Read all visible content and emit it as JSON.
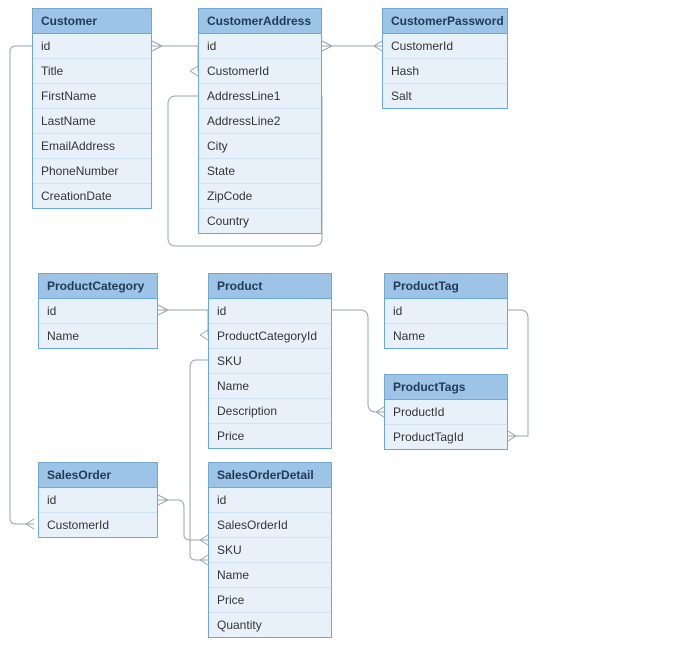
{
  "entities": {
    "customer": {
      "name": "Customer",
      "fields": [
        "id",
        "Title",
        "FirstName",
        "LastName",
        "EmailAddress",
        "PhoneNumber",
        "CreationDate"
      ]
    },
    "customerAddress": {
      "name": "CustomerAddress",
      "fields": [
        "id",
        "CustomerId",
        "AddressLine1",
        "AddressLine2",
        "City",
        "State",
        "ZipCode",
        "Country"
      ]
    },
    "customerPassword": {
      "name": "CustomerPassword",
      "fields": [
        "CustomerId",
        "Hash",
        "Salt"
      ]
    },
    "productCategory": {
      "name": "ProductCategory",
      "fields": [
        "id",
        "Name"
      ]
    },
    "product": {
      "name": "Product",
      "fields": [
        "id",
        "ProductCategoryId",
        "SKU",
        "Name",
        "Description",
        "Price"
      ]
    },
    "productTag": {
      "name": "ProductTag",
      "fields": [
        "id",
        "Name"
      ]
    },
    "productTags": {
      "name": "ProductTags",
      "fields": [
        "ProductId",
        "ProductTagId"
      ]
    },
    "salesOrder": {
      "name": "SalesOrder",
      "fields": [
        "id",
        "CustomerId"
      ]
    },
    "salesOrderDetail": {
      "name": "SalesOrderDetail",
      "fields": [
        "id",
        "SalesOrderId",
        "SKU",
        "Name",
        "Price",
        "Quantity"
      ]
    }
  },
  "relationships": [
    {
      "from": "Customer.id",
      "to": "CustomerAddress.CustomerId",
      "type": "one-to-many"
    },
    {
      "from": "Customer.id",
      "to": "CustomerPassword.CustomerId",
      "type": "one-to-one"
    },
    {
      "from": "Customer.id",
      "to": "SalesOrder.CustomerId",
      "type": "one-to-many"
    },
    {
      "from": "ProductCategory.id",
      "to": "Product.ProductCategoryId",
      "type": "one-to-many"
    },
    {
      "from": "Product.id",
      "to": "ProductTags.ProductId",
      "type": "one-to-many"
    },
    {
      "from": "ProductTag.id",
      "to": "ProductTags.ProductTagId",
      "type": "one-to-many"
    },
    {
      "from": "Product.SKU",
      "to": "SalesOrderDetail.SKU",
      "type": "one-to-many"
    },
    {
      "from": "SalesOrder.id",
      "to": "SalesOrderDetail.SalesOrderId",
      "type": "one-to-many"
    }
  ],
  "colors": {
    "border": "#6ea9d6",
    "header": "#9dc3e6",
    "row": "#e8f1fa",
    "connector": "#9aa5ad"
  }
}
